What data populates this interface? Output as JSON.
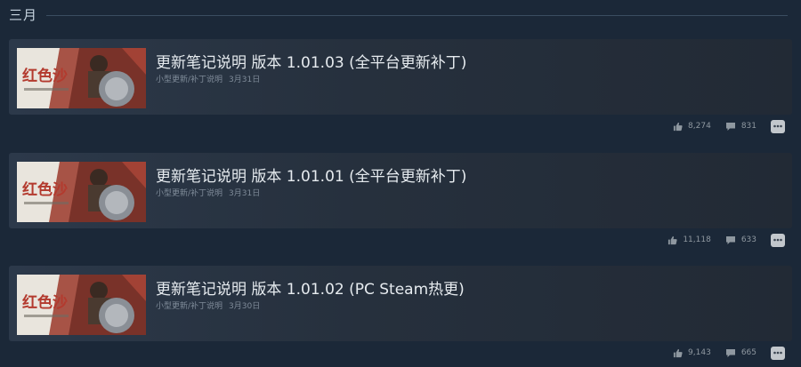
{
  "month_section": {
    "title": "三月"
  },
  "events": [
    {
      "thumbnail_text": "红色沙",
      "title": "更新笔记说明 版本 1.01.03 (全平台更新补丁)",
      "category": "小型更新/补丁说明",
      "date": "3月31日",
      "likes": "8,274",
      "comments": "831"
    },
    {
      "thumbnail_text": "红色沙",
      "title": "更新笔记说明 版本 1.01.01 (全平台更新补丁)",
      "category": "小型更新/补丁说明",
      "date": "3月31日",
      "likes": "11,118",
      "comments": "633"
    },
    {
      "thumbnail_text": "红色沙",
      "title": "更新笔记说明 版本 1.01.02 (PC Steam热更)",
      "category": "小型更新/补丁说明",
      "date": "3月30日",
      "likes": "9,143",
      "comments": "665"
    }
  ],
  "icons": {
    "like": "thumbs-up-icon",
    "comment": "comment-icon",
    "more": "ellipsis-icon"
  },
  "colors": {
    "background": "#1b2838",
    "card": "#2c394a",
    "title": "#e6ebef",
    "meta": "#7f8b99"
  }
}
